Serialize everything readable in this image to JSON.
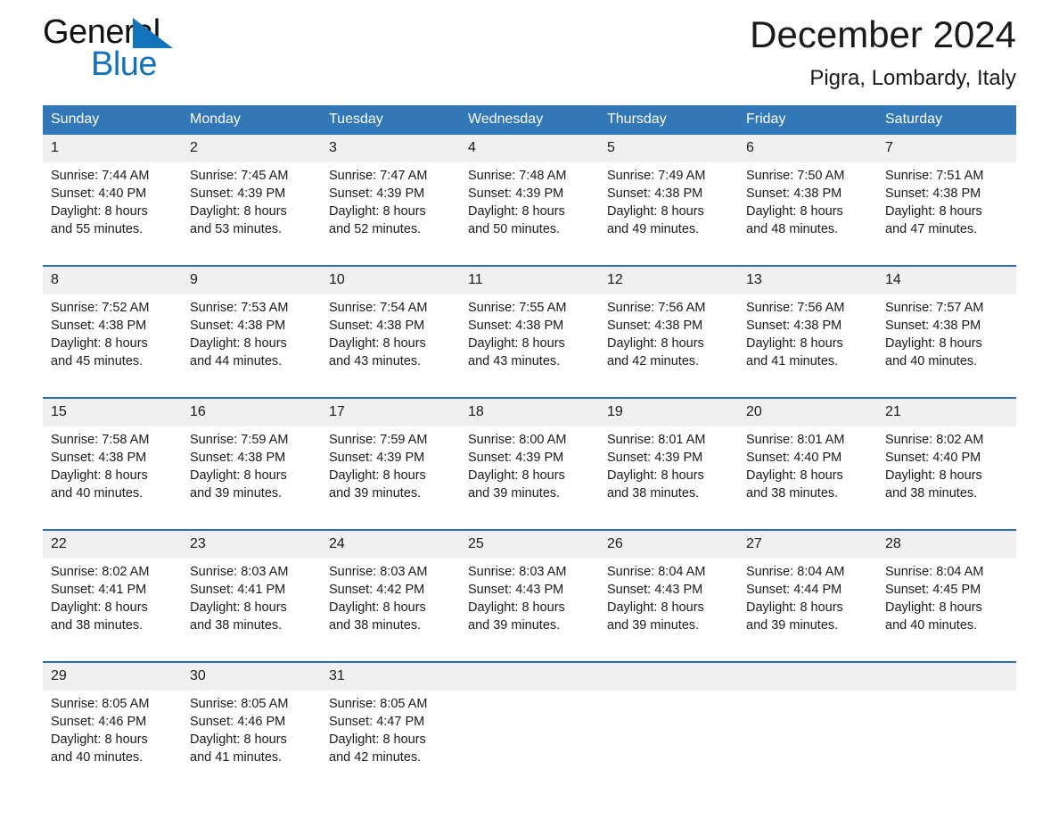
{
  "brand": {
    "name_part1": "General",
    "name_part2": "Blue",
    "triangle_color": "#1273bb"
  },
  "header": {
    "title": "December 2024",
    "location": "Pigra, Lombardy, Italy"
  },
  "colors": {
    "header_band": "#3277b8",
    "week_divider": "#2f6fae",
    "daynum_band": "#f0f0f0",
    "brand_blue": "#1273bb"
  },
  "weekdays": [
    "Sunday",
    "Monday",
    "Tuesday",
    "Wednesday",
    "Thursday",
    "Friday",
    "Saturday"
  ],
  "weeks": [
    [
      {
        "day": "1",
        "sunrise": "Sunrise: 7:44 AM",
        "sunset": "Sunset: 4:40 PM",
        "daylight_line1": "Daylight: 8 hours",
        "daylight_line2": "and 55 minutes."
      },
      {
        "day": "2",
        "sunrise": "Sunrise: 7:45 AM",
        "sunset": "Sunset: 4:39 PM",
        "daylight_line1": "Daylight: 8 hours",
        "daylight_line2": "and 53 minutes."
      },
      {
        "day": "3",
        "sunrise": "Sunrise: 7:47 AM",
        "sunset": "Sunset: 4:39 PM",
        "daylight_line1": "Daylight: 8 hours",
        "daylight_line2": "and 52 minutes."
      },
      {
        "day": "4",
        "sunrise": "Sunrise: 7:48 AM",
        "sunset": "Sunset: 4:39 PM",
        "daylight_line1": "Daylight: 8 hours",
        "daylight_line2": "and 50 minutes."
      },
      {
        "day": "5",
        "sunrise": "Sunrise: 7:49 AM",
        "sunset": "Sunset: 4:38 PM",
        "daylight_line1": "Daylight: 8 hours",
        "daylight_line2": "and 49 minutes."
      },
      {
        "day": "6",
        "sunrise": "Sunrise: 7:50 AM",
        "sunset": "Sunset: 4:38 PM",
        "daylight_line1": "Daylight: 8 hours",
        "daylight_line2": "and 48 minutes."
      },
      {
        "day": "7",
        "sunrise": "Sunrise: 7:51 AM",
        "sunset": "Sunset: 4:38 PM",
        "daylight_line1": "Daylight: 8 hours",
        "daylight_line2": "and 47 minutes."
      }
    ],
    [
      {
        "day": "8",
        "sunrise": "Sunrise: 7:52 AM",
        "sunset": "Sunset: 4:38 PM",
        "daylight_line1": "Daylight: 8 hours",
        "daylight_line2": "and 45 minutes."
      },
      {
        "day": "9",
        "sunrise": "Sunrise: 7:53 AM",
        "sunset": "Sunset: 4:38 PM",
        "daylight_line1": "Daylight: 8 hours",
        "daylight_line2": "and 44 minutes."
      },
      {
        "day": "10",
        "sunrise": "Sunrise: 7:54 AM",
        "sunset": "Sunset: 4:38 PM",
        "daylight_line1": "Daylight: 8 hours",
        "daylight_line2": "and 43 minutes."
      },
      {
        "day": "11",
        "sunrise": "Sunrise: 7:55 AM",
        "sunset": "Sunset: 4:38 PM",
        "daylight_line1": "Daylight: 8 hours",
        "daylight_line2": "and 43 minutes."
      },
      {
        "day": "12",
        "sunrise": "Sunrise: 7:56 AM",
        "sunset": "Sunset: 4:38 PM",
        "daylight_line1": "Daylight: 8 hours",
        "daylight_line2": "and 42 minutes."
      },
      {
        "day": "13",
        "sunrise": "Sunrise: 7:56 AM",
        "sunset": "Sunset: 4:38 PM",
        "daylight_line1": "Daylight: 8 hours",
        "daylight_line2": "and 41 minutes."
      },
      {
        "day": "14",
        "sunrise": "Sunrise: 7:57 AM",
        "sunset": "Sunset: 4:38 PM",
        "daylight_line1": "Daylight: 8 hours",
        "daylight_line2": "and 40 minutes."
      }
    ],
    [
      {
        "day": "15",
        "sunrise": "Sunrise: 7:58 AM",
        "sunset": "Sunset: 4:38 PM",
        "daylight_line1": "Daylight: 8 hours",
        "daylight_line2": "and 40 minutes."
      },
      {
        "day": "16",
        "sunrise": "Sunrise: 7:59 AM",
        "sunset": "Sunset: 4:38 PM",
        "daylight_line1": "Daylight: 8 hours",
        "daylight_line2": "and 39 minutes."
      },
      {
        "day": "17",
        "sunrise": "Sunrise: 7:59 AM",
        "sunset": "Sunset: 4:39 PM",
        "daylight_line1": "Daylight: 8 hours",
        "daylight_line2": "and 39 minutes."
      },
      {
        "day": "18",
        "sunrise": "Sunrise: 8:00 AM",
        "sunset": "Sunset: 4:39 PM",
        "daylight_line1": "Daylight: 8 hours",
        "daylight_line2": "and 39 minutes."
      },
      {
        "day": "19",
        "sunrise": "Sunrise: 8:01 AM",
        "sunset": "Sunset: 4:39 PM",
        "daylight_line1": "Daylight: 8 hours",
        "daylight_line2": "and 38 minutes."
      },
      {
        "day": "20",
        "sunrise": "Sunrise: 8:01 AM",
        "sunset": "Sunset: 4:40 PM",
        "daylight_line1": "Daylight: 8 hours",
        "daylight_line2": "and 38 minutes."
      },
      {
        "day": "21",
        "sunrise": "Sunrise: 8:02 AM",
        "sunset": "Sunset: 4:40 PM",
        "daylight_line1": "Daylight: 8 hours",
        "daylight_line2": "and 38 minutes."
      }
    ],
    [
      {
        "day": "22",
        "sunrise": "Sunrise: 8:02 AM",
        "sunset": "Sunset: 4:41 PM",
        "daylight_line1": "Daylight: 8 hours",
        "daylight_line2": "and 38 minutes."
      },
      {
        "day": "23",
        "sunrise": "Sunrise: 8:03 AM",
        "sunset": "Sunset: 4:41 PM",
        "daylight_line1": "Daylight: 8 hours",
        "daylight_line2": "and 38 minutes."
      },
      {
        "day": "24",
        "sunrise": "Sunrise: 8:03 AM",
        "sunset": "Sunset: 4:42 PM",
        "daylight_line1": "Daylight: 8 hours",
        "daylight_line2": "and 38 minutes."
      },
      {
        "day": "25",
        "sunrise": "Sunrise: 8:03 AM",
        "sunset": "Sunset: 4:43 PM",
        "daylight_line1": "Daylight: 8 hours",
        "daylight_line2": "and 39 minutes."
      },
      {
        "day": "26",
        "sunrise": "Sunrise: 8:04 AM",
        "sunset": "Sunset: 4:43 PM",
        "daylight_line1": "Daylight: 8 hours",
        "daylight_line2": "and 39 minutes."
      },
      {
        "day": "27",
        "sunrise": "Sunrise: 8:04 AM",
        "sunset": "Sunset: 4:44 PM",
        "daylight_line1": "Daylight: 8 hours",
        "daylight_line2": "and 39 minutes."
      },
      {
        "day": "28",
        "sunrise": "Sunrise: 8:04 AM",
        "sunset": "Sunset: 4:45 PM",
        "daylight_line1": "Daylight: 8 hours",
        "daylight_line2": "and 40 minutes."
      }
    ],
    [
      {
        "day": "29",
        "sunrise": "Sunrise: 8:05 AM",
        "sunset": "Sunset: 4:46 PM",
        "daylight_line1": "Daylight: 8 hours",
        "daylight_line2": "and 40 minutes."
      },
      {
        "day": "30",
        "sunrise": "Sunrise: 8:05 AM",
        "sunset": "Sunset: 4:46 PM",
        "daylight_line1": "Daylight: 8 hours",
        "daylight_line2": "and 41 minutes."
      },
      {
        "day": "31",
        "sunrise": "Sunrise: 8:05 AM",
        "sunset": "Sunset: 4:47 PM",
        "daylight_line1": "Daylight: 8 hours",
        "daylight_line2": "and 42 minutes."
      },
      {
        "day": "",
        "sunrise": "",
        "sunset": "",
        "daylight_line1": "",
        "daylight_line2": ""
      },
      {
        "day": "",
        "sunrise": "",
        "sunset": "",
        "daylight_line1": "",
        "daylight_line2": ""
      },
      {
        "day": "",
        "sunrise": "",
        "sunset": "",
        "daylight_line1": "",
        "daylight_line2": ""
      },
      {
        "day": "",
        "sunrise": "",
        "sunset": "",
        "daylight_line1": "",
        "daylight_line2": ""
      }
    ]
  ]
}
